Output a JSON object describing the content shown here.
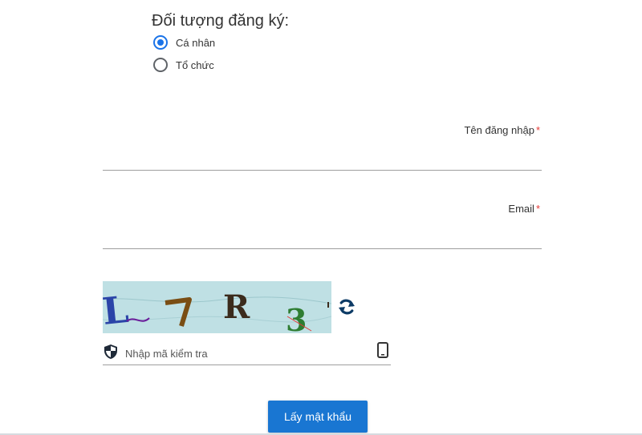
{
  "registration_type": {
    "title": "Đối tượng đăng ký:",
    "options": [
      {
        "label": "Cá nhân",
        "checked": true
      },
      {
        "label": "Tổ chức",
        "checked": false
      }
    ]
  },
  "username": {
    "label": "Tên đăng nhập",
    "required_mark": "*",
    "value": ""
  },
  "email": {
    "label": "Email",
    "required_mark": "*",
    "value": ""
  },
  "captcha": {
    "image_text": "L7R3",
    "placeholder": "Nhập mã kiểm tra",
    "refresh_icon": "refresh-icon",
    "shield_icon": "shield-icon",
    "phone_icon": "phone-icon"
  },
  "submit": {
    "label": "Lấy mật khẩu"
  },
  "colors": {
    "accent": "#1a73e8",
    "button": "#1976d2",
    "required": "#e53935",
    "captcha_bg": "#bfe0e4"
  }
}
